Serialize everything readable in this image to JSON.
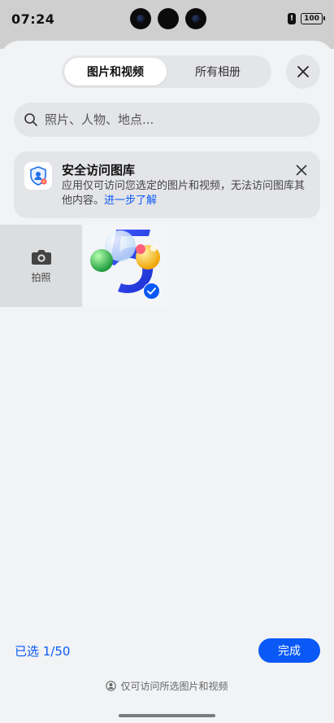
{
  "status_bar": {
    "time": "07:24",
    "battery": "100",
    "alert": "!"
  },
  "tabs": [
    {
      "label": "图片和视频",
      "active": true
    },
    {
      "label": "所有相册",
      "active": false
    }
  ],
  "search": {
    "placeholder": "照片、人物、地点..."
  },
  "banner": {
    "title": "安全访问图库",
    "text": "应用仅可访问您选定的图片和视频，无法访问图库其他内容。",
    "link": "进一步了解"
  },
  "grid": {
    "camera_label": "拍照",
    "photos": [
      {
        "icon": "number-5-with-balls-image",
        "selected": true
      }
    ]
  },
  "footer": {
    "selected_label": "已选 1/50",
    "done_label": "完成",
    "privacy_note": "仅可访问所选图片和视频"
  },
  "colors": {
    "accent": "#0a59f7",
    "sheet_bg": "#f1f3f5",
    "control_bg": "#e4e5e8"
  }
}
